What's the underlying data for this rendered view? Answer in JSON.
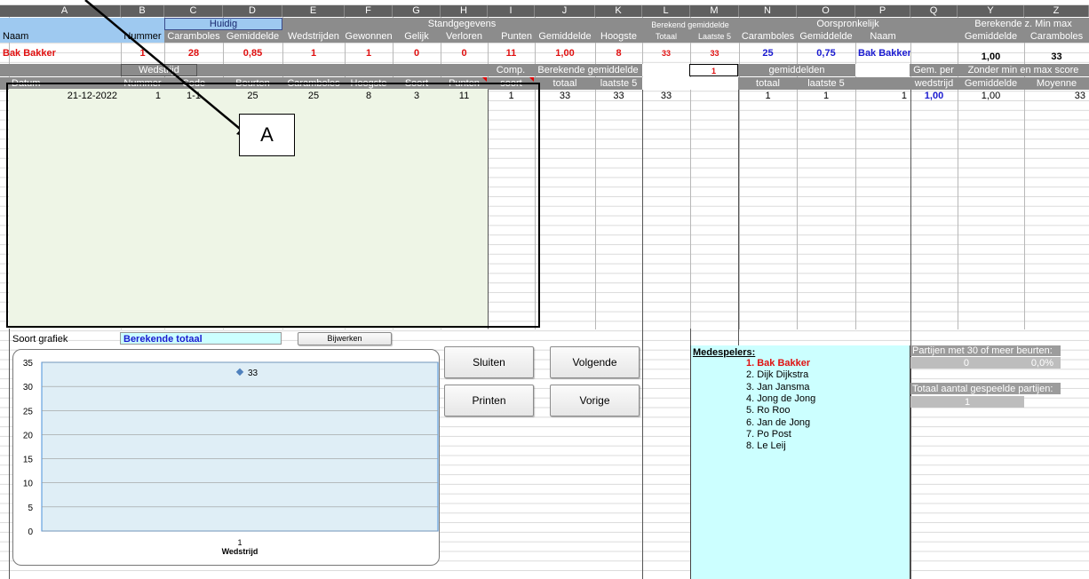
{
  "columns": [
    "A",
    "B",
    "C",
    "D",
    "E",
    "F",
    "G",
    "H",
    "I",
    "J",
    "K",
    "L",
    "M",
    "N",
    "O",
    "P",
    "Q",
    "Y",
    "Z"
  ],
  "row1": {
    "huidig": "Huidig",
    "standgegevens": "Standgegevens",
    "berekend_gemiddelde": "Berekend gemiddelde",
    "oorspronkelijk": "Oorspronkelijk",
    "berekende_min_max": "Berekende  z. Min max"
  },
  "row2": {
    "naam": "Naam",
    "nummer": "Nummer",
    "caramboles": "Caramboles",
    "gemiddelde": "Gemiddelde",
    "wedstrijden": "Wedstrijden",
    "gewonnen": "Gewonnen",
    "gelijk": "Gelijk",
    "verloren": "Verloren",
    "punten": "Punten",
    "gemiddelde2": "Gemiddelde",
    "hoogste": "Hoogste",
    "totaal": "Totaal",
    "laatste5": "Laatste 5",
    "o_caramboles": "Caramboles",
    "o_gemiddelde": "Gemiddelde",
    "o_naam": "Naam",
    "b_gemiddelde": "Gemiddelde",
    "b_caramboles": "Caramboles"
  },
  "row3": {
    "naam": "Bak Bakker",
    "nummer": "1",
    "caramboles": "28",
    "gemiddelde": "0,85",
    "wedstrijden": "1",
    "gewonnen": "1",
    "gelijk": "0",
    "verloren": "0",
    "punten": "11",
    "gemiddelde2": "1,00",
    "hoogste": "8",
    "totaal": "33",
    "laatste5": "33",
    "o_caramboles": "25",
    "o_gemiddelde": "0,75",
    "o_naam": "Bak Bakker",
    "b_gemiddelde": "1,00",
    "b_caramboles": "33"
  },
  "row4": {
    "wedstrijd": "Wedstrijd",
    "comp": "Comp.",
    "berekende_gemiddelde": "Berekende gemiddelde",
    "m_value": "1",
    "gemiddelden": "gemiddelden",
    "gem_per": "Gem. per",
    "zonder": "Zonder min en max score"
  },
  "row5": {
    "datum": "Datum",
    "nummer": "Nummer",
    "code": "Code",
    "beurten": "Beurten",
    "caramboles": "Caramboles",
    "hoogste": "Hoogste",
    "soort": "Soort",
    "punten": "Punten",
    "soort2": "soort",
    "totaal": "totaal",
    "laatste5": "laatste 5",
    "n_totaal": "totaal",
    "o_laatste5": "laatste 5",
    "wedstrijd": "wedstrijd",
    "gemiddelde": "Gemiddelde",
    "moyenne": "Moyenne"
  },
  "data_row": {
    "datum": "21-12-2022",
    "nummer": "1",
    "code": "1-1",
    "beurten": "25",
    "caramboles": "25",
    "hoogste": "8",
    "soort": "3",
    "punten": "11",
    "comp": "1",
    "totaal": "33",
    "laatste5": "33",
    "l": "33",
    "n": "1",
    "o": "1",
    "p": "1",
    "q": "1,00",
    "y": "1,00",
    "z": "33"
  },
  "annotation_label": "A",
  "controls": {
    "soort_grafiek_label": "Soort grafiek",
    "soort_grafiek_value": "Berekende totaal",
    "bijwerken": "Bijwerken",
    "sluiten": "Sluiten",
    "volgende": "Volgende",
    "printen": "Printen",
    "vorige": "Vorige"
  },
  "medespelers": {
    "title": "Medespelers:",
    "players": [
      "1. Bak Bakker",
      "2. Dijk Dijkstra",
      "3. Jan Jansma",
      "4. Jong de Jong",
      "5. Ro Roo",
      "6. Jan de Jong",
      "7. Po Post",
      "8. Le Leij"
    ]
  },
  "stats": {
    "partijen_label": "Partijen met 30 of meer beurten:",
    "partijen_count": "0",
    "partijen_pct": "0,0%",
    "totaal_label": "Totaal aantal gespeelde partijen:",
    "totaal_count": "1"
  },
  "colors": {
    "accent_red": "#e01010",
    "accent_blue": "#1a1ad0",
    "panel_cyan": "#ccffff",
    "input_green": "#eef5e6",
    "chart_bg": "#dfeef6"
  },
  "chart_data": {
    "type": "scatter",
    "categories": [
      "1"
    ],
    "values": [
      33
    ],
    "data_labels": [
      "33"
    ],
    "xlabel": "Wedstrijd",
    "ylim": [
      0,
      35
    ],
    "yticks": [
      0,
      5,
      10,
      15,
      20,
      25,
      30,
      35
    ],
    "grid": true
  }
}
